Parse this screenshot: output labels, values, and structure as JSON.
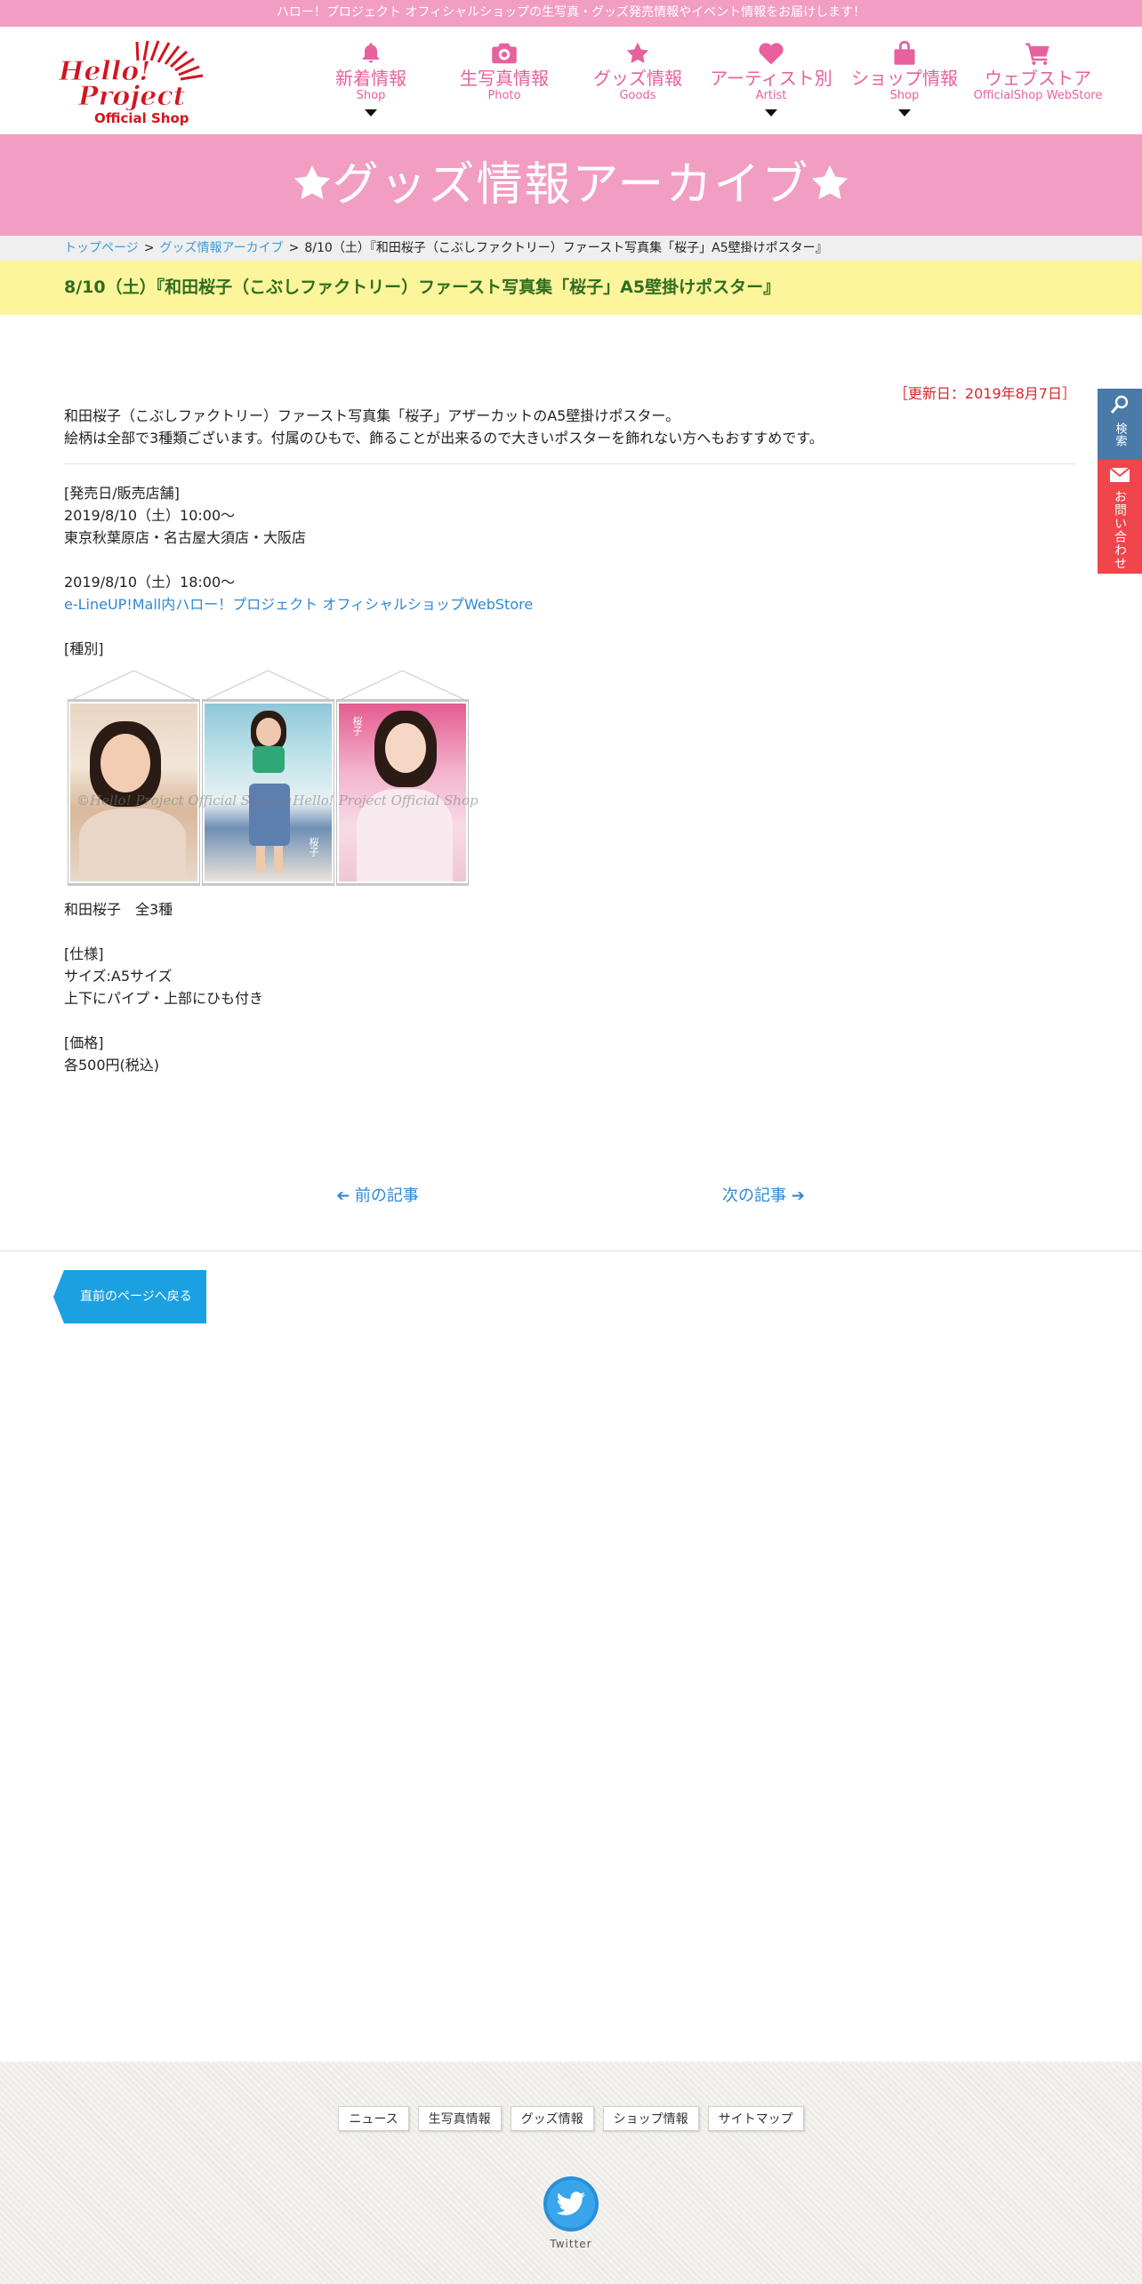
{
  "topbar": {
    "text": "ハロー！プロジェクト オフィシャルショップの生写真・グッズ発売情報やイベント情報をお届けします！"
  },
  "logo": {
    "line1": "Hello! Project",
    "line2": "Official Shop"
  },
  "nav": [
    {
      "ja": "新着情報",
      "en": "Shop",
      "icon": "bell-icon",
      "dropdown": true
    },
    {
      "ja": "生写真情報",
      "en": "Photo",
      "icon": "camera-icon",
      "dropdown": false
    },
    {
      "ja": "グッズ情報",
      "en": "Goods",
      "icon": "star-icon",
      "dropdown": false
    },
    {
      "ja": "アーティスト別",
      "en": "Artist",
      "icon": "heart-icon",
      "dropdown": true
    },
    {
      "ja": "ショップ情報",
      "en": "Shop",
      "icon": "shopping-bag-icon",
      "dropdown": true
    },
    {
      "ja": "ウェブストア",
      "en": "OfficialShop WebStore",
      "icon": "cart-icon",
      "dropdown": false
    }
  ],
  "banner": {
    "title": "グッズ情報アーカイブ"
  },
  "breadcrumb": {
    "home": "トップページ",
    "archive": "グッズ情報アーカイブ",
    "current": "8/10（土）『和田桜子（こぶしファクトリー）ファースト写真集「桜子」A5壁掛けポスター』"
  },
  "article": {
    "title": "8/10（土）『和田桜子（こぶしファクトリー）ファースト写真集「桜子」A5壁掛けポスター』",
    "updated": "［更新日：2019年8月7日］",
    "intro1": "和田桜子（こぶしファクトリー）ファースト写真集「桜子」アザーカットのA5壁掛けポスター。",
    "intro2": "絵柄は全部で3種類ございます。付属のひもで、飾ることが出来るので大きいポスターを飾れない方へもおすすめです。",
    "sale_heading": "[発売日/販売店舗]",
    "sale_date1": "2019/8/10（土）10:00〜",
    "sale_shops1": "東京秋葉原店・名古屋大須店・大阪店",
    "sale_date2": "2019/8/10（土）18:00〜",
    "sale_link": "e-LineUP!Mall内ハロー！プロジェクト オフィシャルショップWebStore",
    "kind_heading": "[種別]",
    "watermark": "©Hello! Project Official Shop",
    "poster_caption": "桜子",
    "kind_text": "和田桜子　全3種",
    "spec_heading": "[仕様]",
    "spec1": "サイズ:A5サイズ",
    "spec2": "上下にパイプ・上部にひも付き",
    "price_heading": "[価格]",
    "price": "各500円(税込)"
  },
  "pager": {
    "prev": "前の記事",
    "next": "次の記事"
  },
  "back_button": "直前のページへ戻る",
  "side": {
    "search": "検索",
    "contact": "お問い合わせ"
  },
  "footer": {
    "links": [
      "ニュース",
      "生写真情報",
      "グッズ情報",
      "ショップ情報",
      "サイトマップ"
    ],
    "twitter": "Twitter"
  },
  "colors": {
    "pink": "#f19ec2",
    "nav_pink": "#e8609d",
    "yellow": "#fdf59c",
    "title_green": "#2e6d1f",
    "link_blue": "#2e88d5",
    "update_red": "#d9252b",
    "logo_red": "#d5141e"
  }
}
